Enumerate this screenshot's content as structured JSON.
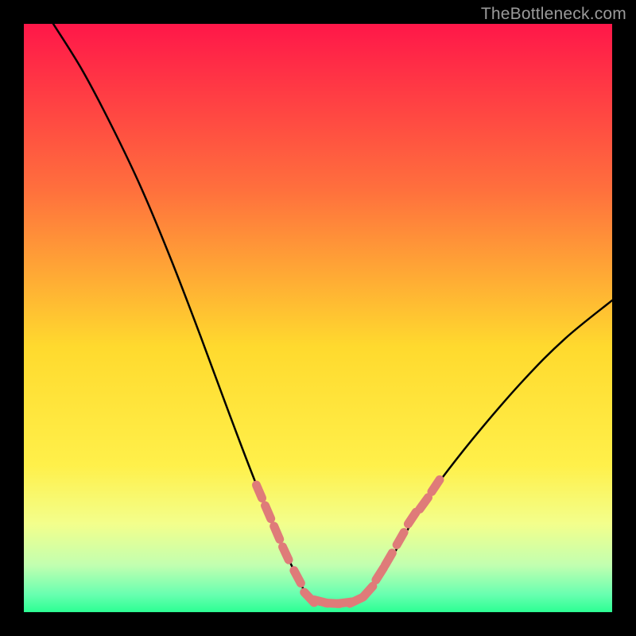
{
  "watermark": "TheBottleneck.com",
  "chart_data": {
    "type": "line",
    "title": "",
    "xlabel": "",
    "ylabel": "",
    "xlim": [
      0,
      100
    ],
    "ylim": [
      0,
      100
    ],
    "gradient_colors": {
      "top": "#ff1749",
      "upper_mid": "#ff863a",
      "mid": "#ffe62c",
      "lower_mid": "#e0f53a",
      "bottom_yellow": "#f3ff8c",
      "green_light": "#9dffb3",
      "green_bright": "#2cff93"
    },
    "curve": {
      "description": "V-shaped bottleneck curve with trough near x≈49-57",
      "points": [
        {
          "x": 5.0,
          "y": 100.0
        },
        {
          "x": 10.0,
          "y": 92.0
        },
        {
          "x": 15.0,
          "y": 82.5
        },
        {
          "x": 20.0,
          "y": 72.0
        },
        {
          "x": 25.0,
          "y": 60.0
        },
        {
          "x": 30.0,
          "y": 47.0
        },
        {
          "x": 35.0,
          "y": 33.5
        },
        {
          "x": 40.0,
          "y": 20.5
        },
        {
          "x": 45.0,
          "y": 9.0
        },
        {
          "x": 49.0,
          "y": 2.0
        },
        {
          "x": 53.0,
          "y": 1.5
        },
        {
          "x": 57.0,
          "y": 2.0
        },
        {
          "x": 62.0,
          "y": 8.5
        },
        {
          "x": 67.0,
          "y": 17.0
        },
        {
          "x": 72.0,
          "y": 24.0
        },
        {
          "x": 78.0,
          "y": 31.5
        },
        {
          "x": 85.0,
          "y": 39.5
        },
        {
          "x": 92.0,
          "y": 46.5
        },
        {
          "x": 100.0,
          "y": 53.0
        }
      ]
    },
    "markers": {
      "color": "#df7b79",
      "points": [
        {
          "x": 40.0,
          "y": 20.5
        },
        {
          "x": 41.5,
          "y": 17.0
        },
        {
          "x": 43.0,
          "y": 13.5
        },
        {
          "x": 44.5,
          "y": 10.0
        },
        {
          "x": 46.5,
          "y": 6.0
        },
        {
          "x": 48.5,
          "y": 2.5
        },
        {
          "x": 50.5,
          "y": 1.8
        },
        {
          "x": 52.5,
          "y": 1.5
        },
        {
          "x": 54.5,
          "y": 1.6
        },
        {
          "x": 56.5,
          "y": 2.0
        },
        {
          "x": 58.5,
          "y": 3.5
        },
        {
          "x": 60.5,
          "y": 6.5
        },
        {
          "x": 62.0,
          "y": 9.0
        },
        {
          "x": 64.0,
          "y": 12.5
        },
        {
          "x": 66.0,
          "y": 16.0
        },
        {
          "x": 68.0,
          "y": 18.5
        },
        {
          "x": 70.0,
          "y": 21.5
        }
      ]
    }
  }
}
